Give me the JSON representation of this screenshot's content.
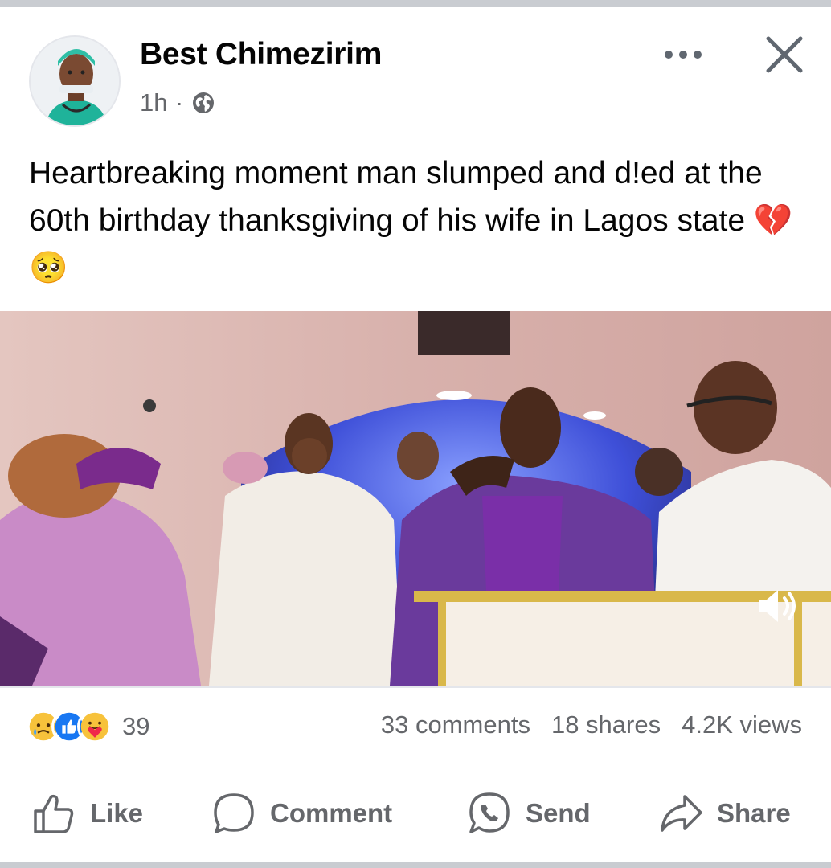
{
  "post": {
    "author": "Best Chimezirim",
    "time": "1h",
    "separator": "·",
    "audience_icon": "globe-icon",
    "text": "Heartbreaking moment man slumped and d!ed at the 60th birthday thanksgiving of his wife in Lagos state 💔🥺"
  },
  "header_controls": {
    "more_icon": "more-options-icon",
    "close_icon": "close-icon"
  },
  "engagement": {
    "reaction_icons": [
      "sad-reaction-icon",
      "like-reaction-icon",
      "care-reaction-icon"
    ],
    "reactions_count": "39",
    "comments": "33 comments",
    "shares": "18 shares",
    "views": "4.2K views"
  },
  "actions": {
    "like": "Like",
    "comment": "Comment",
    "send": "Send",
    "share": "Share"
  },
  "colors": {
    "text": "#050505",
    "muted": "#65676b",
    "divider": "#e4e6eb",
    "like_blue": "#1877f2",
    "reaction_yellow": "#f7c23b"
  }
}
